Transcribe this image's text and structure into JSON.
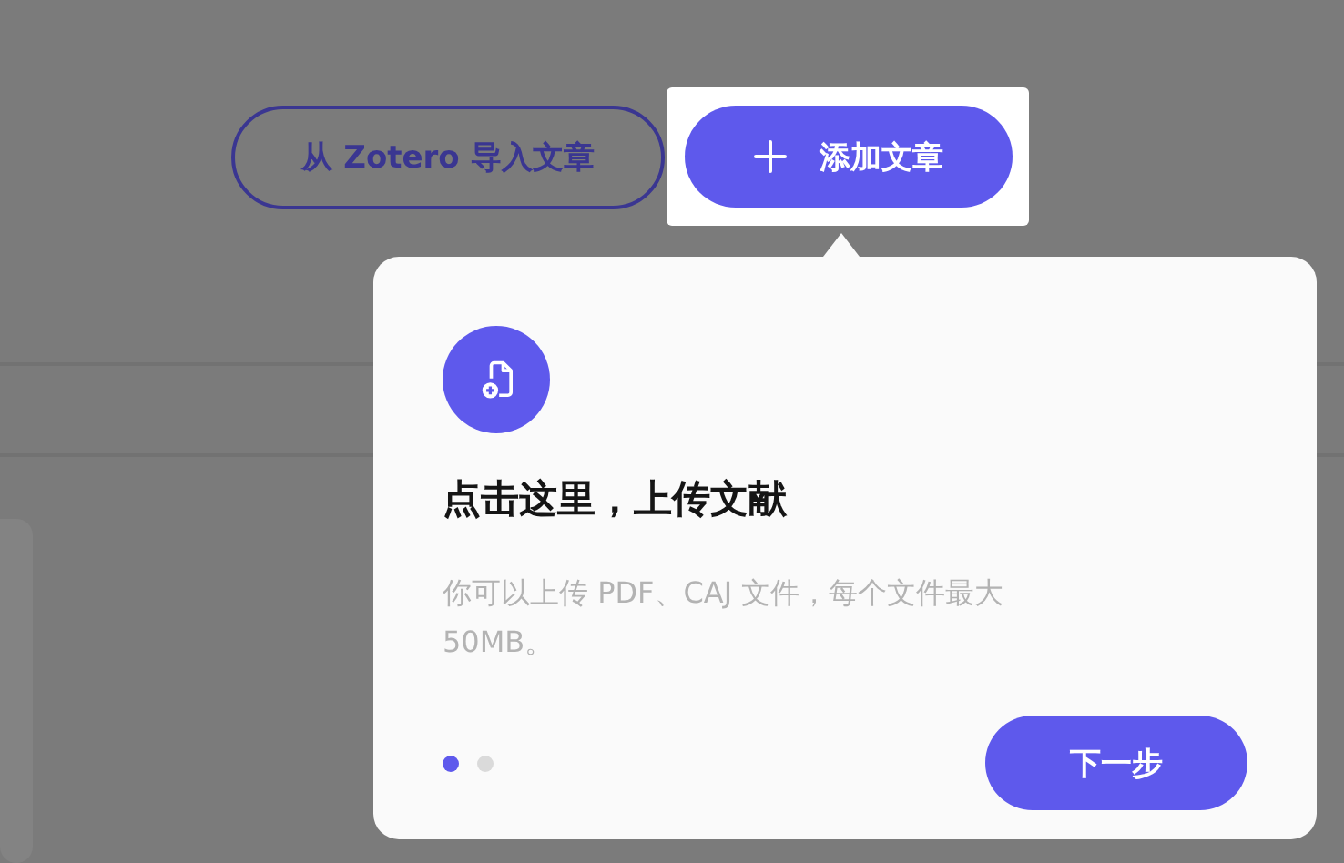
{
  "toolbar": {
    "buttons": [
      {
        "label": "从 Zotero 导入文章",
        "kind": "outline"
      },
      {
        "label": "添加文章",
        "kind": "primary"
      }
    ]
  },
  "tour": {
    "title": "点击这里，上传文献",
    "description": "你可以上传 PDF、CAJ 文件，每个文件最大 50MB。",
    "steps": [
      {
        "selected": true
      },
      {
        "selected": false
      }
    ],
    "next_button": "下一步"
  }
}
